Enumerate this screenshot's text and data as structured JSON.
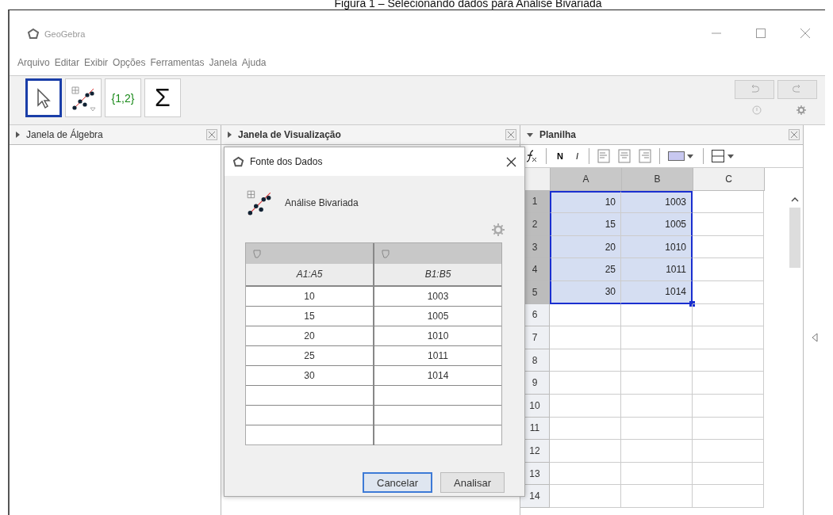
{
  "caption": "Figura 1 – Selecionando dados para Análise Bivariada",
  "window": {
    "title": "GeoGebra"
  },
  "menu": [
    "Arquivo",
    "Editar",
    "Exibir",
    "Opções",
    "Ferramentas",
    "Janela",
    "Ajuda"
  ],
  "tools": [
    {
      "kind": "pointer",
      "selected": true
    },
    {
      "kind": "two-variable",
      "selected": false
    },
    {
      "kind": "list",
      "label": "{1,2}",
      "selected": false
    },
    {
      "kind": "sum",
      "label": "Σ",
      "selected": false
    }
  ],
  "panels": [
    {
      "title": "Janela de Álgebra",
      "expanded": false
    },
    {
      "title": "Janela de Visualização",
      "expanded": false
    },
    {
      "title": "Planilha",
      "expanded": true
    }
  ],
  "dialog": {
    "title": "Fonte dos Dados",
    "mode": "Análise Bivariada",
    "columns": [
      "A1:A5",
      "B1:B5"
    ],
    "rows": [
      [
        "10",
        "1003"
      ],
      [
        "15",
        "1005"
      ],
      [
        "20",
        "1010"
      ],
      [
        "25",
        "1011"
      ],
      [
        "30",
        "1014"
      ]
    ],
    "buttons": [
      {
        "label": "Cancelar",
        "focused": true
      },
      {
        "label": "Analisar",
        "focused": false
      }
    ]
  },
  "spreadsheet": {
    "format": {
      "bold": "N",
      "italic": "I"
    },
    "columns": [
      {
        "label": "A",
        "selected": true
      },
      {
        "label": "B",
        "selected": true
      },
      {
        "label": "C",
        "selected": false
      }
    ],
    "rows": [
      {
        "label": "1",
        "selected": true,
        "cells": [
          "10",
          "1003"
        ]
      },
      {
        "label": "2",
        "selected": true,
        "cells": [
          "15",
          "1005"
        ]
      },
      {
        "label": "3",
        "selected": true,
        "cells": [
          "20",
          "1010"
        ]
      },
      {
        "label": "4",
        "selected": true,
        "cells": [
          "25",
          "1011"
        ]
      },
      {
        "label": "5",
        "selected": true,
        "cells": [
          "30",
          "1014"
        ]
      },
      {
        "label": "6",
        "selected": false,
        "cells": []
      },
      {
        "label": "7",
        "selected": false,
        "cells": []
      },
      {
        "label": "8",
        "selected": false,
        "cells": []
      },
      {
        "label": "9",
        "selected": false,
        "cells": []
      },
      {
        "label": "10",
        "selected": false,
        "cells": []
      },
      {
        "label": "11",
        "selected": false,
        "cells": []
      },
      {
        "label": "12",
        "selected": false,
        "cells": []
      },
      {
        "label": "13",
        "selected": false,
        "cells": []
      },
      {
        "label": "14",
        "selected": false,
        "cells": []
      }
    ]
  }
}
